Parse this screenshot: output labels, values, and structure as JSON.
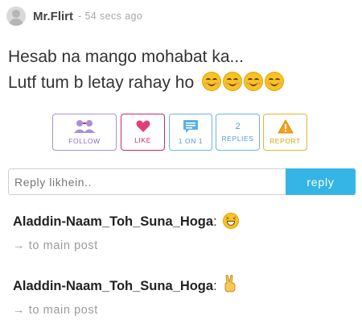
{
  "post": {
    "author": "Mr.Flirt",
    "timestamp": "- 54 secs ago",
    "lines": [
      "Hesab na mango mohabat ka...",
      "Lutf tum b letay rahay ho"
    ],
    "emoji_count": 4
  },
  "actions": {
    "follow_label": "FOLLOW",
    "like_label": "LIKE",
    "one_on_one_label": "1 ON 1",
    "replies_count": "2",
    "replies_label": "REPLIES",
    "report_label": "REPORT"
  },
  "reply_box": {
    "placeholder": "Reply likhein..",
    "button_label": "reply"
  },
  "replies": [
    {
      "author": "Aladdin-Naam_Toh_Suna_Hoga",
      "separator": ":",
      "emoji": "grinning-squinting-face",
      "link": "→ to main post"
    },
    {
      "author": "Aladdin-Naam_Toh_Suna_Hoga",
      "separator": ":",
      "emoji": "victory-hand",
      "link": "→ to main post"
    }
  ],
  "colors": {
    "follow": "#8a6bc7",
    "like": "#c8286e",
    "info": "#4f9bd9",
    "report": "#d9a113",
    "reply_button": "#34b5e6"
  }
}
